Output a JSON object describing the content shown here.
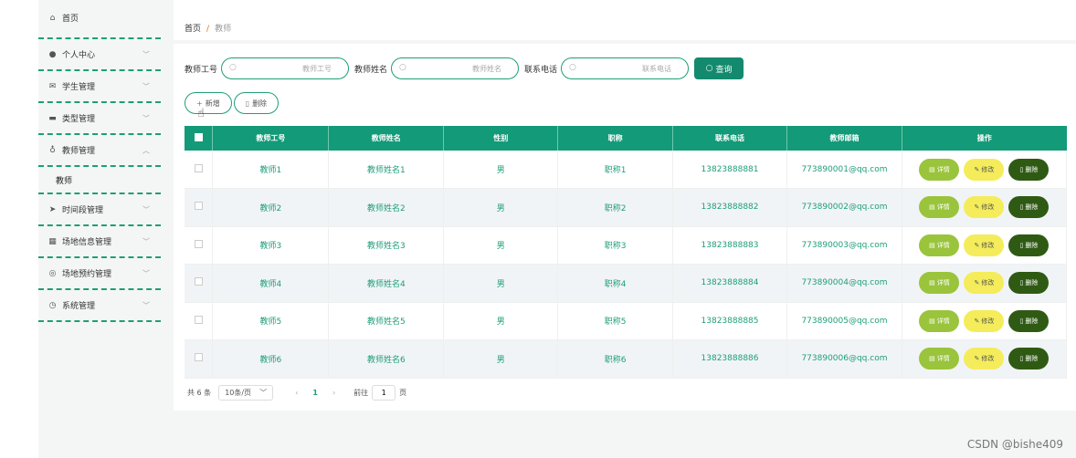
{
  "sidebar": {
    "items": [
      {
        "label": "首页",
        "icon": "home-icon"
      },
      {
        "label": "个人中心",
        "icon": "user-icon"
      },
      {
        "label": "学生管理",
        "icon": "mail-icon"
      },
      {
        "label": "类型管理",
        "icon": "briefcase-icon"
      },
      {
        "label": "教师管理",
        "icon": "microphone-icon"
      },
      {
        "label": "时间段管理",
        "icon": "send-icon"
      },
      {
        "label": "场地信息管理",
        "icon": "grid-icon"
      },
      {
        "label": "场地预约管理",
        "icon": "target-icon"
      },
      {
        "label": "系统管理",
        "icon": "gauge-icon"
      }
    ],
    "submenu_label": "教师"
  },
  "breadcrumb": {
    "home": "首页",
    "separator": "/",
    "current": "教师"
  },
  "search": {
    "field1_label": "教师工号",
    "field1_placeholder": "教师工号",
    "field2_label": "教师姓名",
    "field2_placeholder": "教师姓名",
    "field3_label": "联系电话",
    "field3_placeholder": "联系电话",
    "button_label": "查询"
  },
  "actions": {
    "add_label": "新增",
    "delete_label": "删除"
  },
  "table": {
    "headers": [
      "教师工号",
      "教师姓名",
      "性别",
      "职称",
      "联系电话",
      "教师邮箱",
      "操作"
    ],
    "rows": [
      [
        "教师1",
        "教师姓名1",
        "男",
        "职称1",
        "13823888881",
        "773890001@qq.com"
      ],
      [
        "教师2",
        "教师姓名2",
        "男",
        "职称2",
        "13823888882",
        "773890002@qq.com"
      ],
      [
        "教师3",
        "教师姓名3",
        "男",
        "职称3",
        "13823888883",
        "773890003@qq.com"
      ],
      [
        "教师4",
        "教师姓名4",
        "男",
        "职称4",
        "13823888884",
        "773890004@qq.com"
      ],
      [
        "教师5",
        "教师姓名5",
        "男",
        "职称5",
        "13823888885",
        "773890005@qq.com"
      ],
      [
        "教师6",
        "教师姓名6",
        "男",
        "职称6",
        "13823888886",
        "773890006@qq.com"
      ]
    ],
    "op_detail": "详情",
    "op_edit": "修改",
    "op_delete": "删除"
  },
  "pagination": {
    "total_text": "共 6 条",
    "page_size": "10条/页",
    "current_page": "1",
    "goto_prefix": "前往",
    "goto_value": "1",
    "goto_suffix": "页"
  },
  "watermark": "CSDN @bishe409",
  "colors": {
    "accent": "#139a78",
    "detail": "#9ac43c",
    "edit": "#f4ec5a",
    "delete": "#2f5a14"
  }
}
